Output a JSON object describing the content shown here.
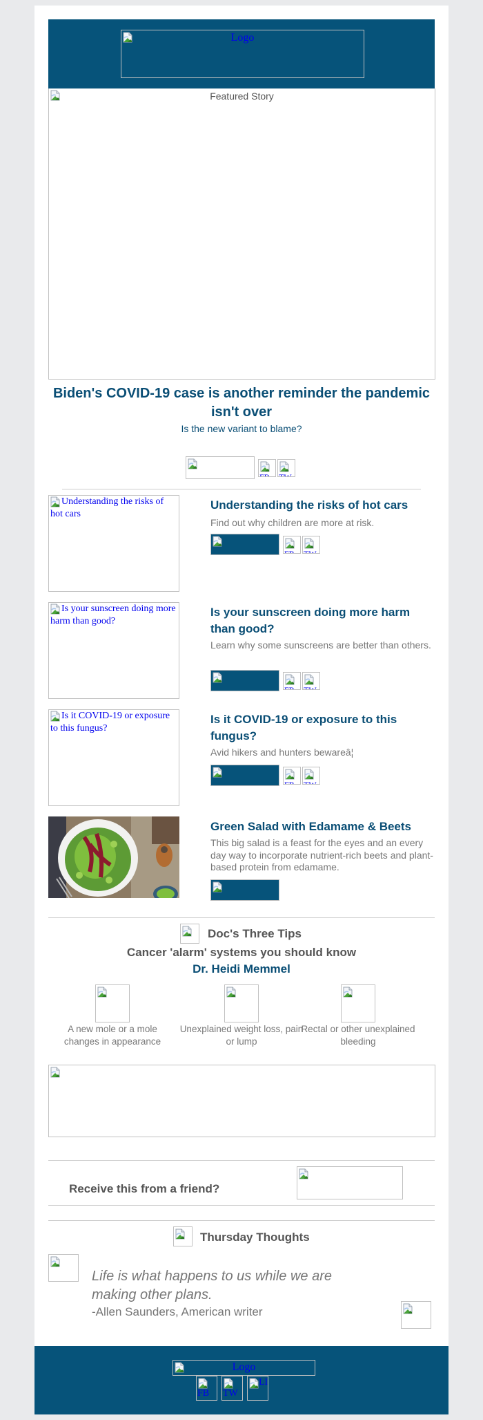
{
  "header": {
    "logo_alt": "Logo"
  },
  "featured": {
    "image_alt": "Featured Story",
    "title": "Biden's COVID-19 case is another reminder the pandemic isn't over",
    "subtitle": "Is the new variant to blame?",
    "social": [
      "FB",
      "TW"
    ]
  },
  "articles": [
    {
      "image_alt": "Understanding the risks of hot cars",
      "title": "Understanding the risks of hot cars",
      "description": "Find out why children are more at risk.",
      "social": [
        "FB",
        "TW"
      ]
    },
    {
      "image_alt": "Is your sunscreen doing more harm than good?",
      "title": "Is your sunscreen doing more harm than good?",
      "description": "Learn why some sunscreens are better than others.",
      "social": [
        "FB",
        "TW"
      ]
    },
    {
      "image_alt": "Is it COVID-19 or exposure to this fungus?",
      "title": "Is it COVID-19 or exposure to this fungus?",
      "description": "Avid hikers and hunters bewareâ¦",
      "social": [
        "FB",
        "TW"
      ]
    },
    {
      "image_alt": "Green salad with edamame and beets",
      "title": "Green Salad with Edamame & Beets",
      "description": "This big salad is a feast for the eyes and an every day way to incorporate nutrient-rich beets and plant-based protein from edamame."
    }
  ],
  "tips": {
    "heading": "Doc's Three Tips",
    "subheading": "Cancer 'alarm' systems you should know",
    "author": "Dr. Heidi Memmel",
    "items": [
      {
        "label": "A new mole or a mole changes in appearance"
      },
      {
        "label": "Unexplained weight loss, pain or lump"
      },
      {
        "label": "Rectal or other unexplained bleeding"
      }
    ]
  },
  "friend": {
    "text": "Receive this from a friend?"
  },
  "thoughts": {
    "heading": "Thursday Thoughts",
    "quote": "Life is what happens to us while we are making other plans.",
    "attribution": "-Allen Saunders, American writer"
  },
  "footer": {
    "logo_alt": "Logo",
    "social": [
      "FB",
      "TW",
      "LI"
    ]
  },
  "colors": {
    "brand_blue": "#06537a",
    "title_blue": "#0a4e75",
    "page_bg": "#e9eaec"
  }
}
